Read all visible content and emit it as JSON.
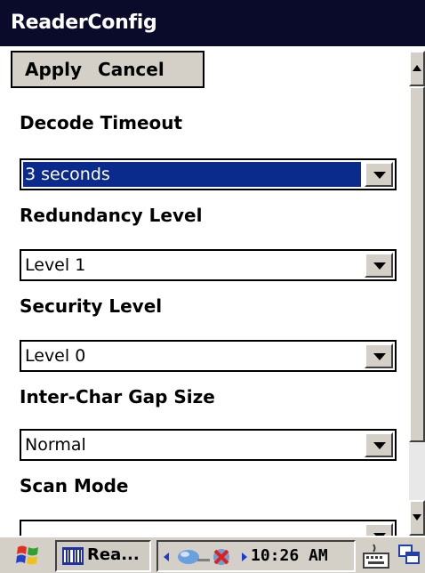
{
  "window": {
    "title": "ReaderConfig"
  },
  "toolbar": {
    "apply_label": "Apply",
    "cancel_label": "Cancel"
  },
  "fields": [
    {
      "label": "Decode Timeout",
      "value": "3 seconds",
      "selected": true
    },
    {
      "label": "Redundancy Level",
      "value": "Level 1",
      "selected": false
    },
    {
      "label": "Security Level",
      "value": "Level 0",
      "selected": false
    },
    {
      "label": "Inter-Char Gap Size",
      "value": "Normal",
      "selected": false
    },
    {
      "label": "Scan Mode",
      "value": "",
      "selected": false
    }
  ],
  "taskbar": {
    "task_label": "Rea...",
    "clock": "10:26 AM",
    "start_icon": "windows-flag-icon",
    "tray_icons": [
      "network-icon",
      "disconnected-icon"
    ],
    "keyboard_icon": "keyboard-icon",
    "desktop_icon": "show-desktop-icon"
  },
  "colors": {
    "titlebar": "#0a0a2a",
    "selection": "#0a2a8c",
    "chrome": "#d4d0c8"
  }
}
